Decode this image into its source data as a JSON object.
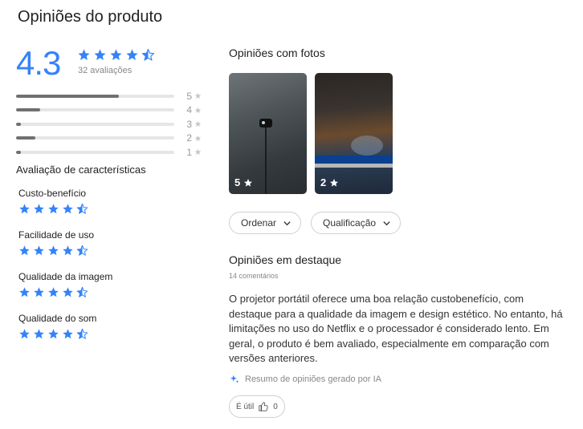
{
  "page_title": "Opiniões do produto",
  "overall": {
    "rating": "4.3",
    "review_count": "32 avaliações",
    "star_fill": [
      1,
      1,
      1,
      1,
      0.5
    ]
  },
  "distribution": [
    {
      "label": "5",
      "fraction": 0.65
    },
    {
      "label": "4",
      "fraction": 0.15
    },
    {
      "label": "3",
      "fraction": 0.03
    },
    {
      "label": "2",
      "fraction": 0.12
    },
    {
      "label": "1",
      "fraction": 0.03
    }
  ],
  "characteristics": {
    "title": "Avaliação de características",
    "items": [
      {
        "label": "Custo-benefício",
        "star_fill": [
          1,
          1,
          1,
          1,
          0.5
        ]
      },
      {
        "label": "Facilidade de uso",
        "star_fill": [
          1,
          1,
          1,
          1,
          0.5
        ]
      },
      {
        "label": "Qualidade da imagem",
        "star_fill": [
          1,
          1,
          1,
          1,
          0.5
        ]
      },
      {
        "label": "Qualidade do som",
        "star_fill": [
          1,
          1,
          1,
          1,
          0.5
        ]
      }
    ]
  },
  "photos": {
    "title": "Opiniões com fotos",
    "items": [
      {
        "rating": "5"
      },
      {
        "rating": "2"
      }
    ]
  },
  "filters": {
    "sort_label": "Ordenar",
    "rating_label": "Qualificação"
  },
  "featured": {
    "title": "Opiniões em destaque",
    "comments": "14 comentários",
    "summary": "O projetor portátil oferece uma boa relação custobenefício, com destaque para a qualidade da imagem e design estético. No entanto, há limitações no uso do Netflix e o processador é considerado lento. Em geral, o produto é bem avaliado, especialmente em comparação com versões anteriores.",
    "ai_note": "Resumo de opiniões gerado por IA",
    "useful_label": "É útil",
    "useful_count": "0"
  },
  "colors": {
    "accent": "#3483fa",
    "bar_fill": "#707070",
    "bar_track": "#e6e6e6"
  },
  "icons": [
    "star-icon",
    "star-half-icon",
    "chevron-down-icon",
    "sparkle-icon",
    "thumbs-up-icon"
  ]
}
